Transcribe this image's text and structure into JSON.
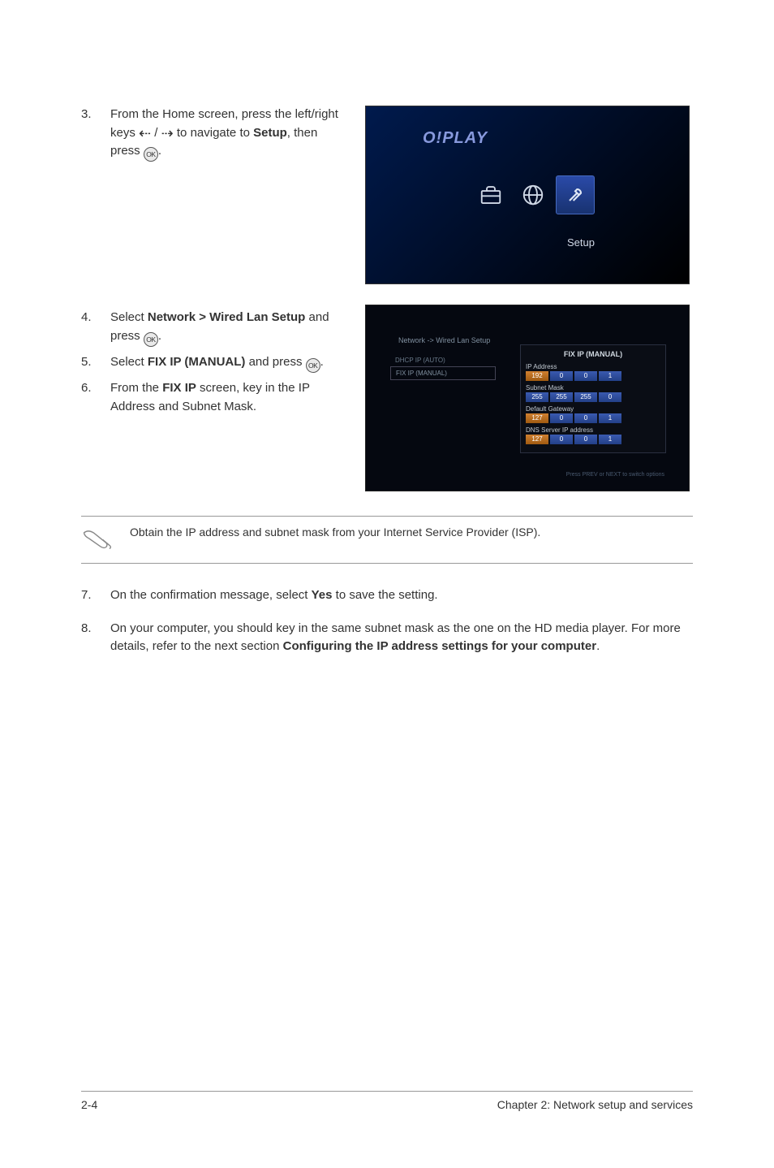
{
  "step3": {
    "num": "3.",
    "text_a": "From the Home screen, press the left/right keys ",
    "text_b": " / ",
    "text_c": " to navigate to ",
    "setup": "Setup",
    "text_d": ", then press ",
    "text_e": "."
  },
  "screenshot_setup": {
    "logo": "O!PLAY",
    "label": "Setup"
  },
  "step4": {
    "num": "4.",
    "text_a": "Select ",
    "bold": "Network > Wired Lan Setup",
    "text_b": " and press ",
    "text_c": "."
  },
  "step5": {
    "num": "5.",
    "text_a": "Select ",
    "bold": "FIX IP (MANUAL)",
    "text_b": " and press ",
    "text_c": "."
  },
  "step6": {
    "num": "6.",
    "text_a": "From the ",
    "bold": "FIX IP",
    "text_b": " screen, key in the IP Address and Subnet Mask."
  },
  "screenshot_network": {
    "breadcrumb": "Network -> Wired Lan Setup",
    "left_items": [
      "DHCP IP (AUTO)",
      "FIX IP (MANUAL)"
    ],
    "right_title": "FIX IP (MANUAL)",
    "fields": [
      {
        "label": "IP Address",
        "values": [
          "192",
          "0",
          "0",
          "1"
        ]
      },
      {
        "label": "Subnet Mask",
        "values": [
          "255",
          "255",
          "255",
          "0"
        ]
      },
      {
        "label": "Default Gateway",
        "values": [
          "127",
          "0",
          "0",
          "1"
        ]
      },
      {
        "label": "DNS Server IP address",
        "values": [
          "127",
          "0",
          "0",
          "1"
        ]
      }
    ],
    "footer_hint": "Press PREV or NEXT to switch options"
  },
  "note": {
    "text": "Obtain the IP address and subnet mask from your Internet Service Provider (ISP)."
  },
  "step7": {
    "num": "7.",
    "text_a": "On the confirmation message, select ",
    "bold": "Yes",
    "text_b": " to save the setting."
  },
  "step8": {
    "num": "8.",
    "text_a": "On your computer, you should key in the same subnet mask as the one on the HD media player. For more details, refer to the next section ",
    "bold": "Configuring the IP address settings for your computer",
    "text_b": "."
  },
  "footer": {
    "left": "2-4",
    "right": "Chapter 2:  Network setup and services"
  },
  "ok_label": "OK"
}
